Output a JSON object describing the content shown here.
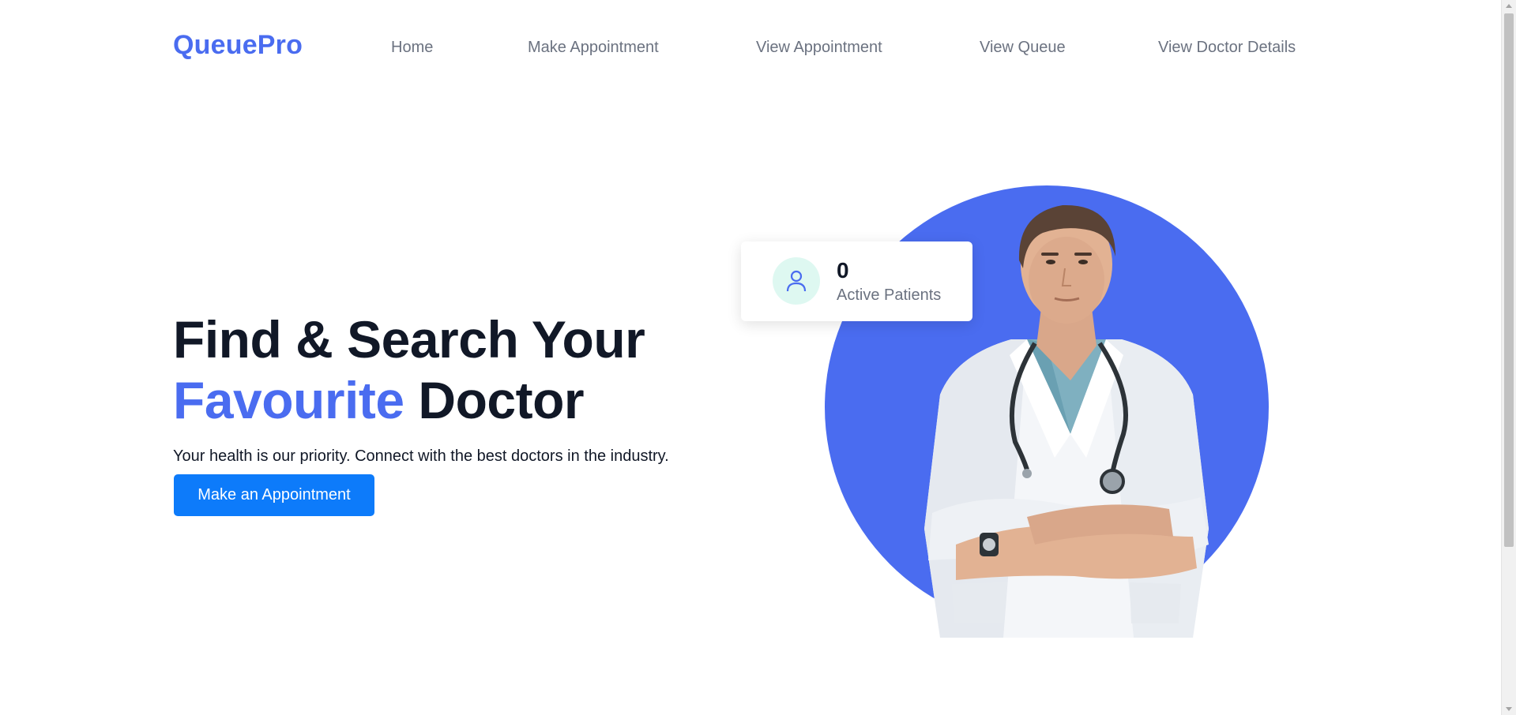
{
  "navbar": {
    "brand": "QueuePro",
    "links": [
      {
        "label": "Home"
      },
      {
        "label": "Make Appointment"
      },
      {
        "label": "View Appointment"
      },
      {
        "label": "View Queue"
      },
      {
        "label": "View Doctor Details"
      }
    ]
  },
  "hero": {
    "title_line1": "Find & Search Your",
    "title_accent": "Favourite",
    "title_rest": " Doctor",
    "subtitle": "Your health is our priority. Connect with the best doctors in the industry.",
    "cta_label": "Make an Appointment"
  },
  "stat_card": {
    "count": "0",
    "label": "Active Patients",
    "icon": "user-icon"
  },
  "colors": {
    "brand": "#4a6cf0",
    "cta": "#0d7bfa",
    "heading": "#111827",
    "muted": "#6b7280",
    "icon_bg": "#def8f1"
  }
}
